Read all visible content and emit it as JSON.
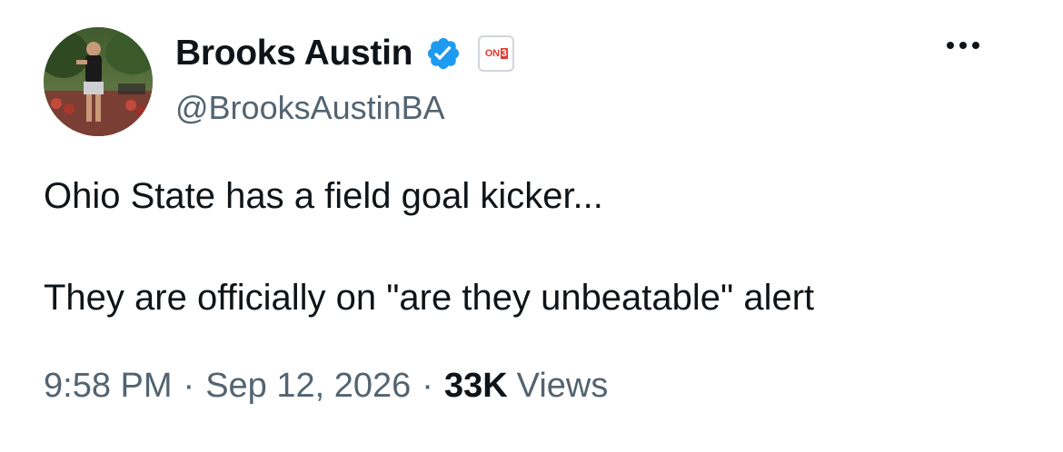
{
  "author": {
    "display_name": "Brooks Austin",
    "handle": "@BrooksAustinBA",
    "verified": true,
    "affiliation_badge": "ON3",
    "avatar_icon": "profile-photo"
  },
  "tweet": {
    "line1": "Ohio State has a field goal kicker...",
    "line2": "They are officially on \"are they unbeatable\" alert"
  },
  "meta": {
    "time": "9:58 PM",
    "separator": "·",
    "date": "Sep 12, 2026",
    "views_count": "33K",
    "views_label": "Views"
  },
  "icons": {
    "more": "more-options-icon",
    "verified": "verified-badge-icon"
  },
  "colors": {
    "text_primary": "#0f1419",
    "text_secondary": "#536471",
    "verified_blue": "#1d9bf0",
    "on3_red": "#e03a2f"
  },
  "badge": {
    "on_text": "ON",
    "num_text": "3"
  }
}
